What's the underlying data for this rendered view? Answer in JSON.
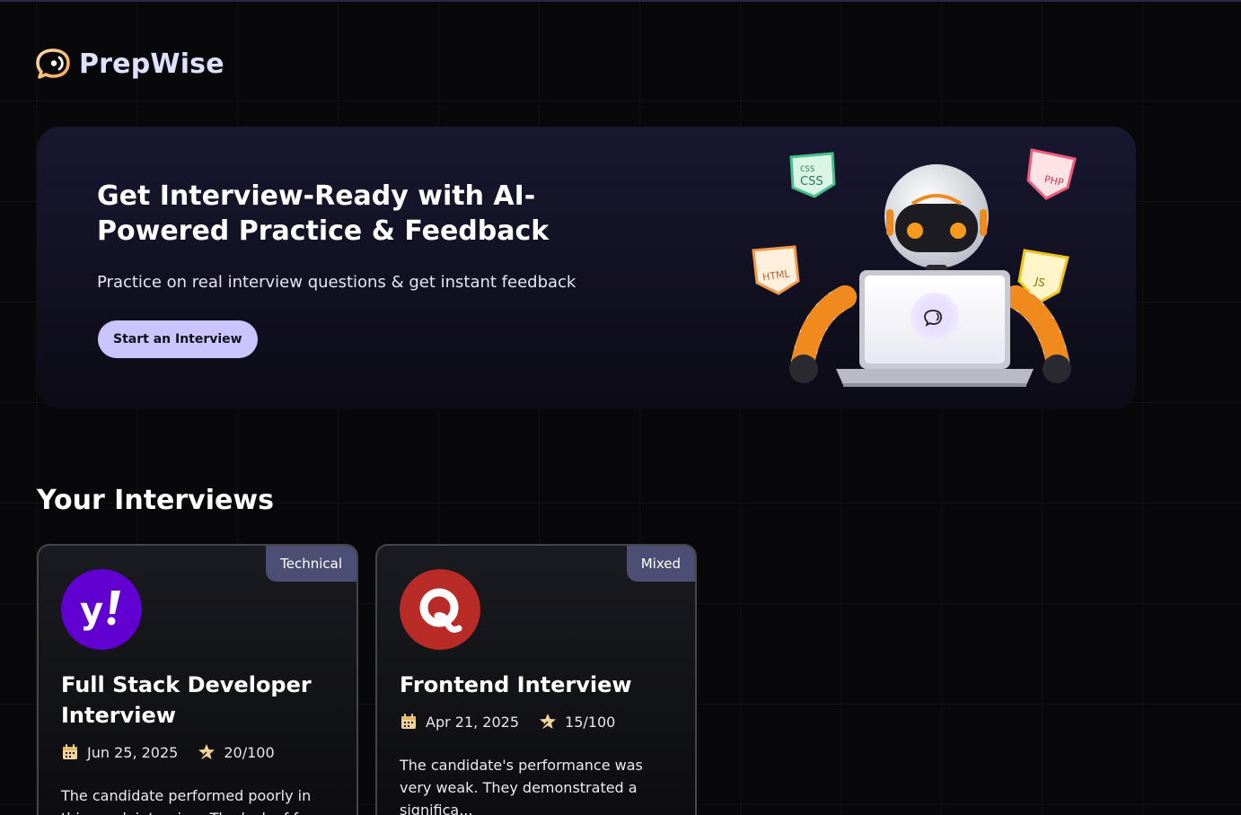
{
  "brand": {
    "name": "PrepWise",
    "icon": "chat-bubble-logo-icon"
  },
  "hero": {
    "title": "Get Interview-Ready with AI-Powered Practice & Feedback",
    "subtitle": "Practice on real interview questions & get instant feedback",
    "cta_label": "Start an Interview",
    "illustration": "robot-with-laptop",
    "tags": [
      "CSS",
      "PHP",
      "HTML",
      "JS"
    ]
  },
  "section": {
    "title": "Your Interviews"
  },
  "interviews": [
    {
      "type": "Technical",
      "title": "Full Stack Developer Interview",
      "date": "Jun 25, 2025",
      "score": "20/100",
      "description": "The candidate performed poorly in this mock interview. The lack of f",
      "logo": "yahoo-logo"
    },
    {
      "type": "Mixed",
      "title": "Frontend Interview",
      "date": "Apr 21, 2025",
      "score": "15/100",
      "description": "The candidate's performance was very weak. They demonstrated a significa...",
      "logo": "quora-logo"
    }
  ],
  "colors": {
    "accent": "#cac4ff",
    "brand_text": "#dfe0ff",
    "badge_bg": "#4b4f73",
    "yahoo_purple": "#6001d2",
    "quora_red": "#b92b27"
  }
}
